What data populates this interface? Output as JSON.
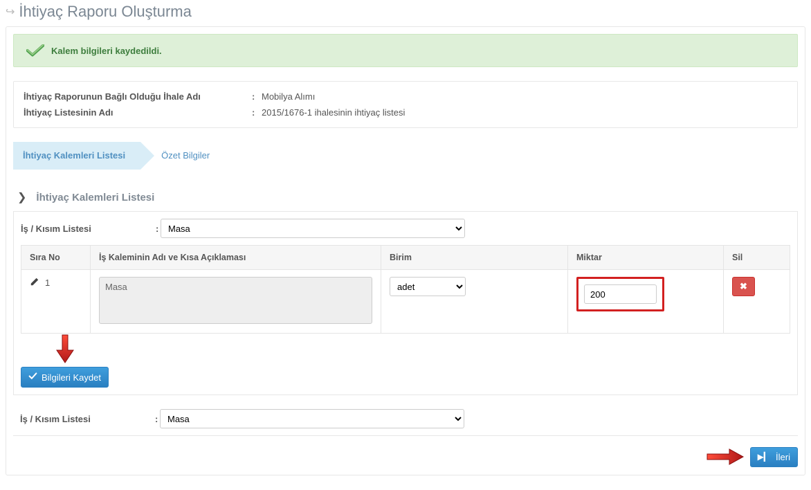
{
  "header": {
    "title": "İhtiyaç Raporu Oluşturma"
  },
  "alert": {
    "message": "Kalem bilgileri kaydedildi."
  },
  "info": {
    "row1_label": "İhtiyaç Raporunun Bağlı Olduğu İhale Adı",
    "row1_value": "Mobilya Alımı",
    "row2_label": "İhtiyaç Listesinin Adı",
    "row2_value": "2015/1676-1 ihalesinin ihtiyaç listesi"
  },
  "wizard": {
    "step1": "İhtiyaç Kalemleri Listesi",
    "step2": "Özet Bilgiler"
  },
  "section": {
    "title": "İhtiyaç Kalemleri Listesi"
  },
  "form": {
    "kisim_label": "İş / Kısım Listesi",
    "kisim_value": "Masa",
    "kisim_value_bottom": "Masa"
  },
  "table": {
    "headers": {
      "sira": "Sıra No",
      "acik": "İş Kaleminin Adı ve Kısa Açıklaması",
      "birim": "Birim",
      "miktar": "Miktar",
      "sil": "Sil"
    },
    "rows": [
      {
        "sira": "1",
        "acik": "Masa",
        "birim": "adet",
        "miktar": "200"
      }
    ]
  },
  "buttons": {
    "save": "Bilgileri Kaydet",
    "next": "İleri"
  },
  "colors": {
    "primary": "#2d87c8",
    "danger": "#d9534f",
    "highlight_border": "#d22020"
  }
}
